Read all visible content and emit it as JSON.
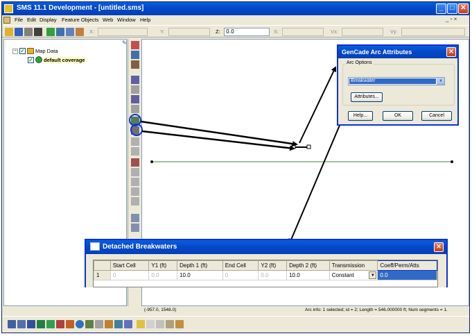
{
  "window": {
    "title": "SMS 11.1 Development - [untitled.sms]",
    "minimize": "_",
    "restore": "□",
    "close": "✕"
  },
  "menu": {
    "items": [
      "File",
      "Edit",
      "Display",
      "Feature Objects",
      "Web",
      "Window",
      "Help"
    ],
    "child_controls": "_ ▫ ×"
  },
  "toolbar": {
    "x_label": "X:",
    "y_label": "Y:",
    "z_label": "Z:",
    "z_value": "0.0",
    "s_label": "S:",
    "vx_label": "Vx:",
    "vy_label": "Vy:"
  },
  "tree": {
    "root": {
      "expander": "−",
      "label": "Map Data"
    },
    "child": {
      "label": "default coverage"
    }
  },
  "status": {
    "coords": "(-957.0, 1548.0)",
    "arc_info": "Arc info: 1 selected; id = 2; Length = 546.000000 ft; Num segments = 1."
  },
  "arc_dialog": {
    "title": "GenCade Arc Attributes",
    "group_label": "Arc Options",
    "option_value": "Breakwater",
    "attributes_button": "Attributes...",
    "help_button": "Help...",
    "ok_button": "OK",
    "cancel_button": "Cancel"
  },
  "breakwater_dialog": {
    "title": "Detached Breakwaters",
    "columns": [
      "",
      "Start Cell",
      "Y1 (ft)",
      "Depth 1 (ft)",
      "End Cell",
      "Y2 (ft)",
      "Depth 2 (ft)",
      "Transmission",
      "Coeff/Perm/Atts"
    ],
    "row": {
      "num": "1",
      "start_cell": "0",
      "y1": "0.0",
      "depth1": "10.0",
      "end_cell": "0",
      "y2": "0.0",
      "depth2": "10.0",
      "transmission": "Constant",
      "coeff": "0.0"
    }
  },
  "colors": {
    "titlebar": "#0548c8",
    "window_bg": "#ece9d8",
    "arc_line": "#3a8a3a",
    "highlight_circle": "#1030e0",
    "selection": "#316ac5"
  },
  "icons": [
    "new-file-icon",
    "open-folder-icon",
    "save-icon",
    "print-icon",
    "delete-icon",
    "zoom-icon",
    "select-arc-icon",
    "create-arc-icon",
    "pin-icon"
  ]
}
